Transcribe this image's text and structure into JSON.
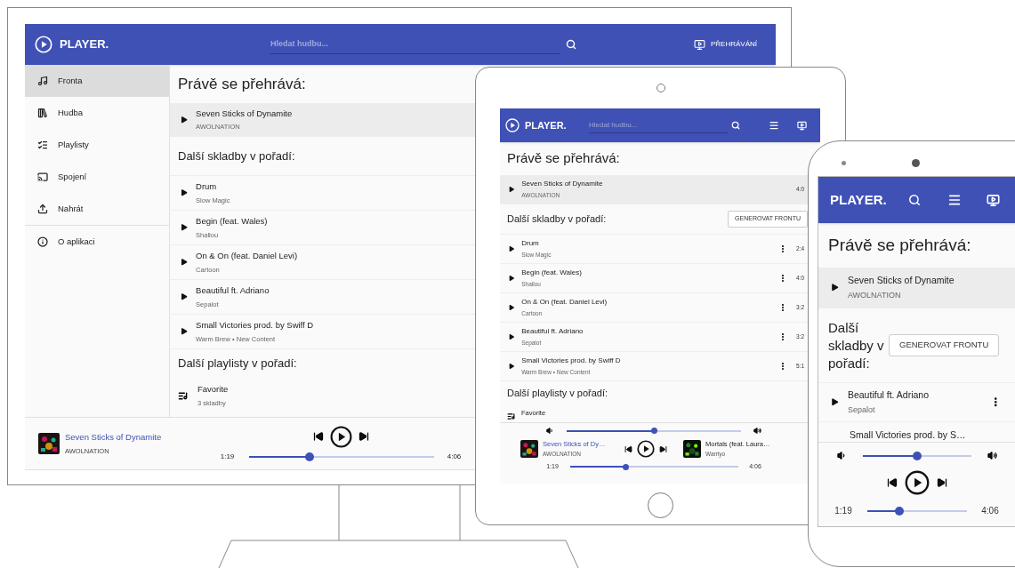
{
  "desktop": {
    "app_name": "PLAYER.",
    "search": {
      "placeholder": "Hledat hudbu..."
    },
    "header_button": "PŘEHRÁVÁNÍ",
    "sidebar": [
      {
        "label": "Fronta",
        "kind": "queue",
        "selected": true
      },
      {
        "label": "Hudba",
        "kind": "library",
        "selected": false
      },
      {
        "label": "Playlisty",
        "kind": "playlists",
        "selected": false
      },
      {
        "label": "Spojení",
        "kind": "cast",
        "selected": false
      },
      {
        "label": "Nahrát",
        "kind": "upload",
        "selected": false
      },
      {
        "label": "O aplikaci",
        "kind": "about",
        "selected": false
      }
    ],
    "now_playing_heading": "Právě se přehrává:",
    "now_playing": {
      "title": "Seven Sticks of Dynamite",
      "artist": "AWOLNATION"
    },
    "queue_heading": "Další skladby v pořadí:",
    "queue": [
      {
        "title": "Drum",
        "artist": "Slow Magic"
      },
      {
        "title": "Begin (feat. Wales)",
        "artist": "Shallou"
      },
      {
        "title": "On & On (feat. Daniel Levi)",
        "artist": "Cartoon"
      },
      {
        "title": "Beautiful ft. Adriano",
        "artist": "Sepalot"
      },
      {
        "title": "Small Victories prod. by Swiff D",
        "artist": "Warm Brew • New Content"
      }
    ],
    "playlists_heading": "Další playlisty v pořadí:",
    "playlists": [
      {
        "title": "Favorite",
        "subtitle": "3 skladby"
      }
    ],
    "player": {
      "title": "Seven Sticks of Dynamite",
      "artist": "AWOLNATION",
      "elapsed": "1:19",
      "total": "4:06",
      "level": 0.33
    }
  },
  "tablet": {
    "app_name": "PLAYER.",
    "search": {
      "placeholder": "Hledat hudbu..."
    },
    "now_playing_heading": "Právě se přehrává:",
    "now_playing": {
      "title": "Seven Sticks of Dynamite",
      "artist": "AWOLNATION",
      "duration": "4:0"
    },
    "queue_heading": "Další skladby v pořadí:",
    "generate_button": "GENEROVAT FRONTU",
    "queue": [
      {
        "title": "Drum",
        "artist": "Slow Magic",
        "duration": "2:4"
      },
      {
        "title": "Begin (feat. Wales)",
        "artist": "Shallou",
        "duration": "4:0"
      },
      {
        "title": "On & On (feat. Daniel Levi)",
        "artist": "Cartoon",
        "duration": "3:2"
      },
      {
        "title": "Beautiful ft. Adriano",
        "artist": "Sepalot",
        "duration": "3:2"
      },
      {
        "title": "Small Victories prod. by Swiff D",
        "artist": "Warm Brew • New Content",
        "duration": "5:1"
      }
    ],
    "playlists_heading": "Další playlisty v pořadí:",
    "playlists": [
      {
        "title": "Favorite"
      }
    ],
    "player": {
      "volume": {
        "level": 0.5
      },
      "title": "Seven Sticks of Dy…",
      "artist": "AWOLNATION",
      "next_title": "Mortals (feat. Laura…",
      "next_artist": "Warriyo",
      "elapsed": "1:19",
      "total": "4:06",
      "level": 0.33
    }
  },
  "phone": {
    "app_name": "PLAYER.",
    "now_playing_heading": "Právě se přehrává:",
    "now_playing": {
      "title": "Seven Sticks of Dynamite",
      "artist": "AWOLNATION"
    },
    "queue_heading": "Další skladby v pořadí:",
    "generate_button": "GENEROVAT FRONTU",
    "queue": [
      {
        "title": "Beautiful ft. Adriano",
        "artist": "Sepalot"
      },
      {
        "title": "Small Victories prod. by S…"
      }
    ],
    "player": {
      "volume": {
        "level": 0.5
      },
      "elapsed": "1:19",
      "total": "4:06",
      "level": 0.32
    }
  }
}
